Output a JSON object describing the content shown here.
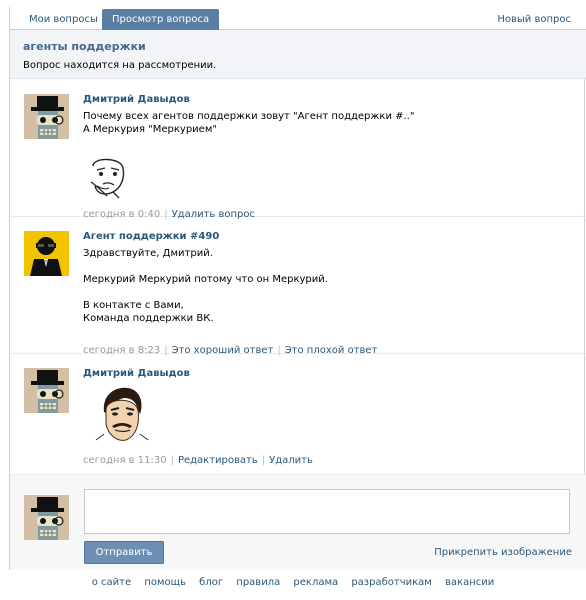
{
  "tabs": {
    "my_questions": "Мои вопросы",
    "view_question": "Просмотр вопроса",
    "new_question": "Новый вопрос"
  },
  "header": {
    "title": "агенты поддержки",
    "status": "Вопрос находится на рассмотрении."
  },
  "posts": [
    {
      "author": "Дмитрий Давыдов",
      "lines": [
        "Почему всех агентов поддержки зовут \"Агент поддержки #..\"",
        "А Меркурия \"Меркурием\""
      ],
      "time": "сегодня в 0:40",
      "actions": [
        "Удалить вопрос"
      ],
      "avatar_icon": "robot-bender-avatar-icon",
      "image_icon": "thinking-meme-face-icon"
    },
    {
      "author": "Агент поддержки #490",
      "lines": [
        "Здравствуйте, Дмитрий.",
        "",
        "Меркурий Меркурий потому что он Меркурий.",
        "",
        "В контакте с Вами,",
        "Команда поддержки ВК."
      ],
      "time": "сегодня в 8:23",
      "actions": [
        "Это хороший ответ",
        "Это плохой ответ"
      ],
      "avatar_icon": "agent-in-black-avatar-icon"
    },
    {
      "author": "Дмитрий Давыдов",
      "time": "сегодня в 11:30",
      "actions": [
        "Редактировать",
        "Удалить"
      ],
      "avatar_icon": "robot-bender-avatar-icon",
      "image_icon": "mercury-meme-face-icon"
    }
  ],
  "reply": {
    "send_label": "Отправить",
    "attach_label": "Прикрепить изображение"
  },
  "footer": [
    "о сайте",
    "помощь",
    "блог",
    "правила",
    "реклама",
    "разработчикам",
    "вакансии"
  ]
}
